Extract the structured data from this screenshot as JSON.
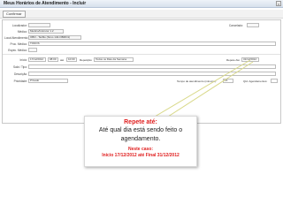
{
  "window": {
    "title": "Meus Horários de Atendimento - Incluir",
    "close_glyph": "x"
  },
  "toolbar": {
    "confirm_label": "Confirmar"
  },
  "form": {
    "localizador": {
      "label": "Localizador:",
      "value": ""
    },
    "cancelado": {
      "label": "Cancelado:",
      "value": ""
    },
    "medico": {
      "label": "Médico:",
      "value": "Medico/Instrutor 1.2"
    },
    "local": {
      "label": "Local Atendimento:",
      "value": "OBO - Tazfilo (Simo 140-OBMO1)"
    },
    "proc_medico": {
      "label": "Proc. Médico:",
      "value": "TODOS"
    },
    "espec_medico": {
      "label": "Espec. Médico:",
      "value": ""
    },
    "inicio": {
      "label": "Início:",
      "date": "17/12/2012",
      "time_from": "08:00",
      "ate_label": "até",
      "time_to": "10:00",
      "repeticao_label": "Repetição:",
      "repeticao_value": "Todos os Dias da Semana",
      "repete_ate_label": "Repete Até:",
      "repete_ate_value": "31/12/2012"
    },
    "sala_tipo": {
      "label": "Sala / Tipo:",
      "value": ""
    },
    "descricao": {
      "label": "Descrição:",
      "value": ""
    },
    "prioridade": {
      "label": "Prioridade:",
      "value": "Privado",
      "tempo_label": "Tempo de atendimento (minutos):",
      "tempo_value": "15",
      "qtd_label": "Qtd. Agendamentos:",
      "qtd_value": ""
    }
  },
  "callout": {
    "heading": "Repete até:",
    "body_line1": "Até qual dia está sendo feito o",
    "body_line2": "agendamento.",
    "sub1": "Neste caso:",
    "sub2": "Inicio 17/12/2012 até Final 31/12/2012"
  },
  "colors": {
    "accent_red": "#e02020",
    "callout_line": "#d9d98a"
  }
}
